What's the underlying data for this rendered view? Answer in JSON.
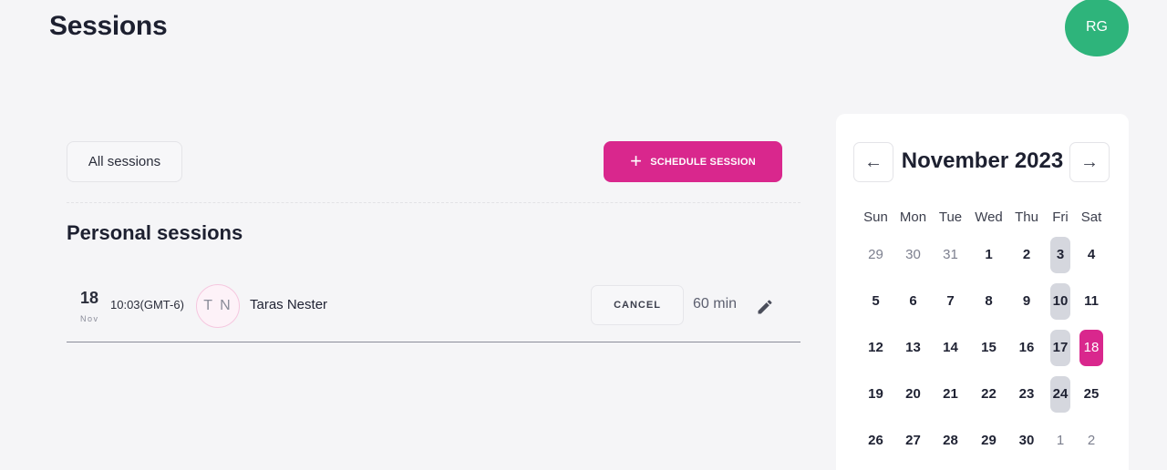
{
  "header": {
    "title": "Sessions",
    "user_initials": "RG"
  },
  "toolbar": {
    "filter_label": "All sessions",
    "schedule_label": "SCHEDULE SESSION",
    "schedule_icon": "+"
  },
  "section": {
    "title": "Personal sessions"
  },
  "sessions": [
    {
      "day": "18",
      "month": "Nov",
      "time": "10:03(GMT-6)",
      "initials": "T N",
      "name": "Taras Nester",
      "cancel_label": "CANCEL",
      "duration": "60 min"
    }
  ],
  "calendar": {
    "title": "November 2023",
    "prev_icon": "←",
    "next_icon": "→",
    "weekdays": [
      "Sun",
      "Mon",
      "Tue",
      "Wed",
      "Thu",
      "Fri",
      "Sat"
    ],
    "days": [
      {
        "label": "29",
        "state": "other"
      },
      {
        "label": "30",
        "state": "other"
      },
      {
        "label": "31",
        "state": "other"
      },
      {
        "label": "1",
        "state": "normal"
      },
      {
        "label": "2",
        "state": "normal"
      },
      {
        "label": "3",
        "state": "highlight"
      },
      {
        "label": "4",
        "state": "normal"
      },
      {
        "label": "5",
        "state": "normal"
      },
      {
        "label": "6",
        "state": "normal"
      },
      {
        "label": "7",
        "state": "normal"
      },
      {
        "label": "8",
        "state": "normal"
      },
      {
        "label": "9",
        "state": "normal"
      },
      {
        "label": "10",
        "state": "highlight"
      },
      {
        "label": "11",
        "state": "normal"
      },
      {
        "label": "12",
        "state": "normal"
      },
      {
        "label": "13",
        "state": "normal"
      },
      {
        "label": "14",
        "state": "normal"
      },
      {
        "label": "15",
        "state": "normal"
      },
      {
        "label": "16",
        "state": "normal"
      },
      {
        "label": "17",
        "state": "highlight"
      },
      {
        "label": "18",
        "state": "selected"
      },
      {
        "label": "19",
        "state": "normal"
      },
      {
        "label": "20",
        "state": "normal"
      },
      {
        "label": "21",
        "state": "normal"
      },
      {
        "label": "22",
        "state": "normal"
      },
      {
        "label": "23",
        "state": "normal"
      },
      {
        "label": "24",
        "state": "highlight"
      },
      {
        "label": "25",
        "state": "normal"
      },
      {
        "label": "26",
        "state": "normal"
      },
      {
        "label": "27",
        "state": "normal"
      },
      {
        "label": "28",
        "state": "normal"
      },
      {
        "label": "29",
        "state": "normal"
      },
      {
        "label": "30",
        "state": "normal"
      },
      {
        "label": "1",
        "state": "other"
      },
      {
        "label": "2",
        "state": "other"
      }
    ]
  },
  "colors": {
    "accent": "#d9278d",
    "avatar": "#2eb47b",
    "highlight": "#d5d7de",
    "background": "#f5f5f7"
  }
}
